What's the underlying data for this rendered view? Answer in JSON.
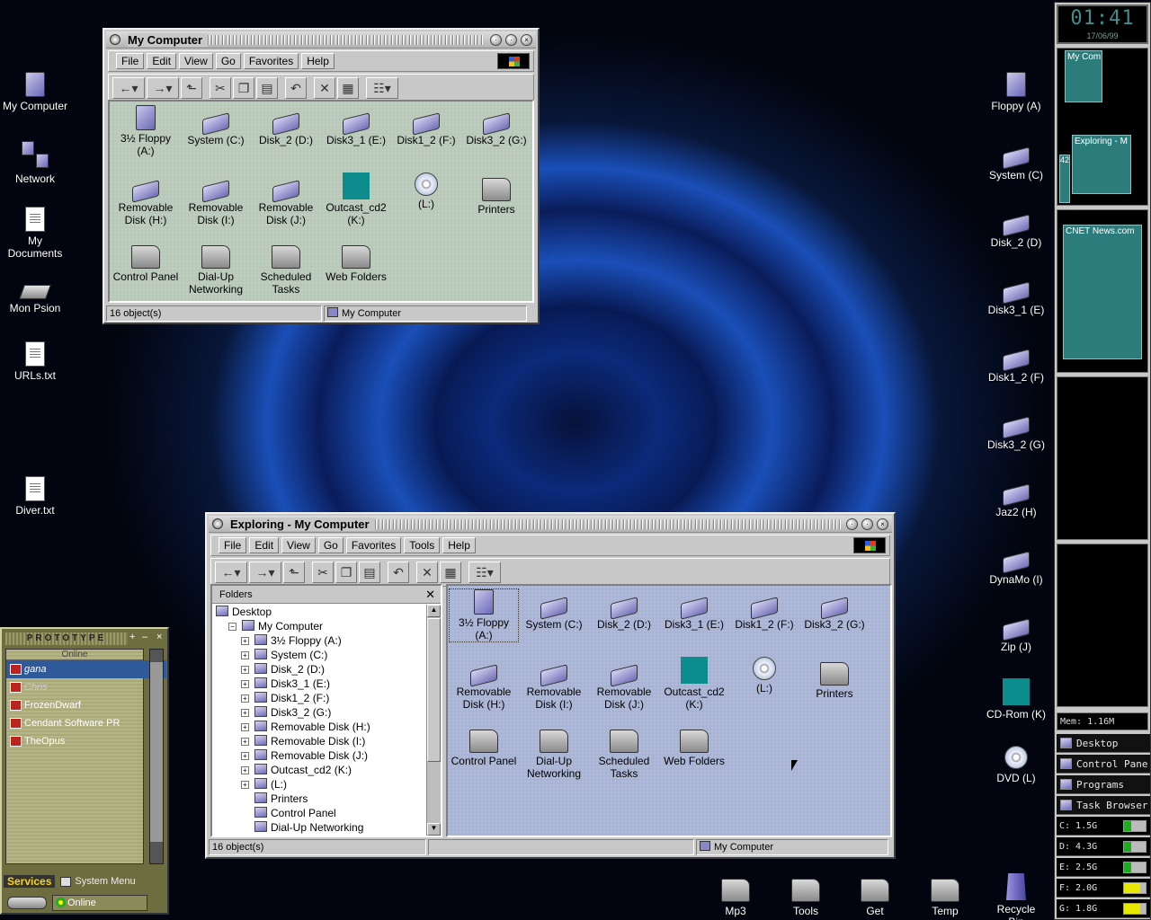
{
  "desktop_left": [
    {
      "label": "My Computer",
      "icon": "computer-icon"
    },
    {
      "label": "Network",
      "icon": "network-icon"
    },
    {
      "label": "My Documents",
      "icon": "documents-icon"
    },
    {
      "label": "Mon Psion",
      "icon": "psion-icon"
    },
    {
      "label": "URLs.txt",
      "icon": "text-file-icon"
    },
    {
      "label": "Diver.txt",
      "icon": "text-file-icon"
    }
  ],
  "desktop_right": [
    {
      "label": "Floppy (A)"
    },
    {
      "label": "System (C)"
    },
    {
      "label": "Disk_2 (D)"
    },
    {
      "label": "Disk3_1 (E)"
    },
    {
      "label": "Disk1_2 (F)"
    },
    {
      "label": "Disk3_2 (G)"
    },
    {
      "label": "Jaz2 (H)"
    },
    {
      "label": "DynaMo (I)"
    },
    {
      "label": "Zip (J)"
    },
    {
      "label": "CD-Rom (K)"
    },
    {
      "label": "DVD (L)"
    }
  ],
  "dock": [
    {
      "label": "Mp3"
    },
    {
      "label": "Tools"
    },
    {
      "label": "Get"
    },
    {
      "label": "Temp"
    },
    {
      "label": "Recycle Bin"
    }
  ],
  "win1": {
    "title": "My Computer",
    "menu": [
      "File",
      "Edit",
      "View",
      "Go",
      "Favorites",
      "Help"
    ],
    "status_count": "16 object(s)",
    "status_location": "My Computer"
  },
  "win2": {
    "title": "Exploring - My Computer",
    "menu": [
      "File",
      "Edit",
      "View",
      "Go",
      "Favorites",
      "Tools",
      "Help"
    ],
    "folders_label": "Folders",
    "status_count": "16 object(s)",
    "status_location": "My Computer",
    "tree": [
      {
        "label": "Desktop",
        "level": 0,
        "pm": ""
      },
      {
        "label": "My Computer",
        "level": 1,
        "pm": "−"
      },
      {
        "label": "3½ Floppy (A:)",
        "level": 2,
        "pm": "+"
      },
      {
        "label": "System (C:)",
        "level": 2,
        "pm": "+"
      },
      {
        "label": "Disk_2 (D:)",
        "level": 2,
        "pm": "+"
      },
      {
        "label": "Disk3_1 (E:)",
        "level": 2,
        "pm": "+"
      },
      {
        "label": "Disk1_2 (F:)",
        "level": 2,
        "pm": "+"
      },
      {
        "label": "Disk3_2 (G:)",
        "level": 2,
        "pm": "+"
      },
      {
        "label": "Removable Disk (H:)",
        "level": 2,
        "pm": "+"
      },
      {
        "label": "Removable Disk (I:)",
        "level": 2,
        "pm": "+"
      },
      {
        "label": "Removable Disk (J:)",
        "level": 2,
        "pm": "+"
      },
      {
        "label": "Outcast_cd2 (K:)",
        "level": 2,
        "pm": "+"
      },
      {
        "label": "(L:)",
        "level": 2,
        "pm": "+"
      },
      {
        "label": "Printers",
        "level": 2,
        "pm": ""
      },
      {
        "label": "Control Panel",
        "level": 2,
        "pm": ""
      },
      {
        "label": "Dial-Up Networking",
        "level": 2,
        "pm": ""
      }
    ]
  },
  "files": [
    {
      "label": "3½ Floppy (A:)",
      "icon": "floppy-icon"
    },
    {
      "label": "System (C:)",
      "icon": "drive-icon"
    },
    {
      "label": "Disk_2 (D:)",
      "icon": "drive-icon"
    },
    {
      "label": "Disk3_1 (E:)",
      "icon": "drive-icon"
    },
    {
      "label": "Disk1_2 (F:)",
      "icon": "drive-icon"
    },
    {
      "label": "Disk3_2 (G:)",
      "icon": "drive-icon"
    },
    {
      "label": "Removable Disk (H:)",
      "icon": "removable-drive-icon"
    },
    {
      "label": "Removable Disk (I:)",
      "icon": "removable-drive-icon"
    },
    {
      "label": "Removable Disk (J:)",
      "icon": "removable-drive-icon"
    },
    {
      "label": "Outcast_cd2 (K:)",
      "icon": "game-cd-icon"
    },
    {
      "label": "(L:)",
      "icon": "cd-icon"
    },
    {
      "label": "Printers",
      "icon": "printer-icon"
    },
    {
      "label": "Control Panel",
      "icon": "control-panel-icon"
    },
    {
      "label": "Dial-Up Networking",
      "icon": "dialup-icon"
    },
    {
      "label": "Scheduled Tasks",
      "icon": "scheduled-tasks-icon"
    },
    {
      "label": "Web Folders",
      "icon": "web-folders-icon"
    }
  ],
  "panel": {
    "clock": "01:41",
    "date": "17/06/99",
    "pager": [
      {
        "label": "My Com"
      },
      {
        "label": "Exploring - M"
      },
      {
        "label": "42"
      },
      {
        "label": "CNET News.com"
      }
    ],
    "mem": "Mem:   1.16M",
    "menu": [
      "Desktop",
      "Control Pane",
      "Programs",
      "Task Browser"
    ],
    "drives": [
      {
        "label": "C: 1.5G",
        "fill": 0.35,
        "color": "#22aa22"
      },
      {
        "label": "D: 4.3G",
        "fill": 0.35,
        "color": "#22aa22"
      },
      {
        "label": "E: 2.5G",
        "fill": 0.35,
        "color": "#22aa22"
      },
      {
        "label": "F: 2.0G",
        "fill": 0.75,
        "color": "#e8e800"
      },
      {
        "label": "G: 1.8G",
        "fill": 0.75,
        "color": "#e8e800"
      }
    ]
  },
  "icq": {
    "title": "PROTOTYPE",
    "online_label": "Online",
    "contacts": [
      {
        "label": "gana",
        "state": "selected"
      },
      {
        "label": "Chris",
        "state": "away"
      },
      {
        "label": "FrozenDwarf",
        "state": "normal"
      },
      {
        "label": "Cendant Software PR",
        "state": "normal"
      },
      {
        "label": "TheOpus",
        "state": "normal"
      }
    ],
    "services_label": "Services",
    "system_menu_label": "System Menu",
    "status_label": "Online"
  }
}
